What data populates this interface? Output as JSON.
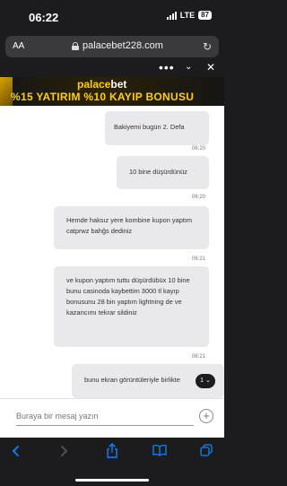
{
  "status": {
    "time": "06:22",
    "network": "LTE",
    "battery": "87"
  },
  "browser": {
    "aa": "AA",
    "url": "palacebet228.com"
  },
  "banner": {
    "brand_part1": "palace",
    "brand_part2": "bet",
    "promo": "%15 YATIRIM %10 KAYIP BONUSU"
  },
  "messages": [
    {
      "text": "Bakiyemi bugün 2. Defa",
      "time": "06:20"
    },
    {
      "text": "10 bine düşürdünüz",
      "time": "06:20"
    },
    {
      "text": "Hemde haksız yere kombine kupon yaptım catprwz bahğs dediniz",
      "time": "06:21"
    },
    {
      "text": "ve kupon yaptım tuttu düşürdübüx 10 bine bunu casinoda kaybettim 3000 tl kayıp bonusunu 28 bin yaptım lightning de ve kazancımı tekrar sildiniz",
      "time": "06:21"
    },
    {
      "text": "bunu ekran görüntüleriyle birlikte",
      "time": ""
    }
  ],
  "scroll_badge": "1",
  "input": {
    "placeholder": "Buraya bir mesaj yazın"
  },
  "icons": {
    "lock": "lock-icon",
    "reload": "reload-icon",
    "more": "more-icon",
    "minimize": "minimize-icon",
    "close": "close-icon",
    "add": "add-icon",
    "back": "back-icon",
    "forward": "forward-icon",
    "share": "share-icon",
    "bookmarks": "bookmarks-icon",
    "tabs": "tabs-icon"
  },
  "colors": {
    "accent": "#ffcc00",
    "bubble": "#e9e9eb",
    "chrome": "#1c1c1e",
    "link": "#0a84ff"
  }
}
